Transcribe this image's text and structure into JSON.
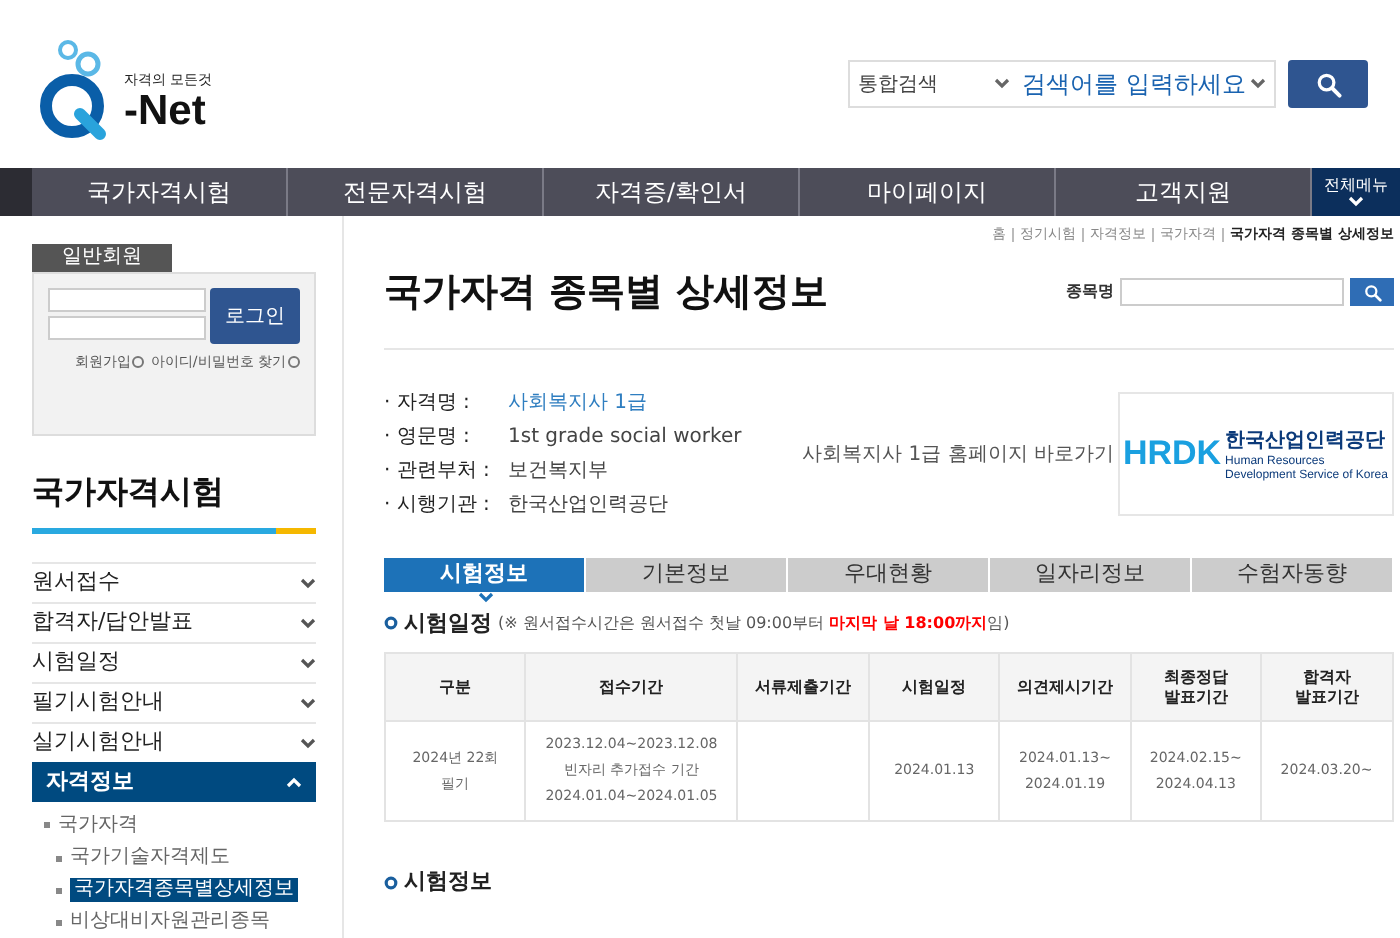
{
  "logo": {
    "tagline": "자격의 모든것",
    "text": "-Net"
  },
  "search": {
    "scope": "통합검색",
    "placeholder": "검색어를 입력하세요"
  },
  "nav": {
    "items": [
      "국가자격시험",
      "전문자격시험",
      "자격증/확인서",
      "마이페이지",
      "고객지원"
    ],
    "all_menu": "전체메뉴"
  },
  "login": {
    "tab": "일반회원",
    "button": "로그인",
    "links": [
      "회원가입",
      "아이디/비밀번호 찾기"
    ]
  },
  "sidebar": {
    "title": "국가자격시험",
    "items": [
      {
        "label": "원서접수",
        "expanded": false
      },
      {
        "label": "합격자/답안발표",
        "expanded": false
      },
      {
        "label": "시험일정",
        "expanded": false
      },
      {
        "label": "필기시험안내",
        "expanded": false
      },
      {
        "label": "실기시험안내",
        "expanded": false
      },
      {
        "label": "자격정보",
        "expanded": true,
        "children": [
          {
            "label": "국가자격",
            "children": [
              {
                "label": "국가기술자격제도",
                "selected": false
              },
              {
                "label": "국가자격종목별상세정보",
                "selected": true
              },
              {
                "label": "비상대비자원관리종목",
                "selected": false
              }
            ]
          }
        ]
      }
    ]
  },
  "breadcrumb": [
    "홈",
    "정기시험",
    "자격정보",
    "국가자격",
    "국가자격 종목별 상세정보"
  ],
  "page_title": "국가자격 종목별 상세정보",
  "item_search": {
    "label": "종목명"
  },
  "info": {
    "rows": [
      {
        "label": "· 자격명 :",
        "value": "사회복지사 1급",
        "kind": "link"
      },
      {
        "label": "· 영문명 :",
        "value": "1st grade social worker",
        "kind": "text"
      },
      {
        "label": "· 관련부처 :",
        "value": "보건복지부",
        "kind": "text"
      },
      {
        "label": "· 시행기관 :",
        "value": "한국산업인력공단",
        "kind": "text"
      }
    ],
    "homepage_link": "사회복지사 1급 홈페이지 바로가기",
    "org_logo": {
      "mark": "HRDK",
      "name": "한국산업인력공단",
      "english": "Human Resources Development Service of Korea"
    }
  },
  "tabs": [
    {
      "label": "시험정보",
      "selected": true
    },
    {
      "label": "기본정보",
      "selected": false
    },
    {
      "label": "우대현황",
      "selected": false
    },
    {
      "label": "일자리정보",
      "selected": false
    },
    {
      "label": "수험자동향",
      "selected": false
    }
  ],
  "schedule": {
    "heading": "시험일정",
    "note": [
      {
        "text": "(※ 원서접수시간은 원서접수 첫날 09:00부터 ",
        "highlight": false
      },
      {
        "text": "마지막 날 18:00까지",
        "highlight": true
      },
      {
        "text": "임)",
        "highlight": false
      }
    ],
    "columns": [
      "구분",
      "접수기간",
      "서류제출기간",
      "시험일정",
      "의견제시기간",
      "최종정답\n발표기간",
      "합격자\n발표기간"
    ],
    "rows": [
      [
        "2024년 22회\n필기",
        "2023.12.04~2023.12.08\n빈자리 추가접수 기간\n2024.01.04~2024.01.05",
        "",
        "2024.01.13",
        "2024.01.13~\n2024.01.19",
        "2024.02.15~\n2024.04.13",
        "2024.03.20~"
      ]
    ]
  },
  "exam_info": {
    "heading": "시험정보"
  }
}
